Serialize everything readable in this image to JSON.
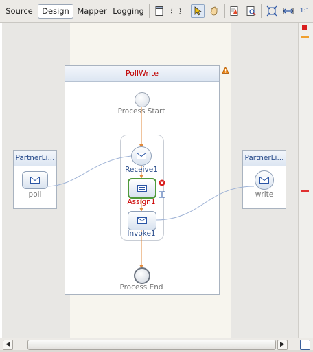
{
  "tabs": [
    {
      "label": "Source",
      "active": false
    },
    {
      "label": "Design",
      "active": true
    },
    {
      "label": "Mapper",
      "active": false
    },
    {
      "label": "Logging",
      "active": false
    }
  ],
  "toolbar_icons": [
    "palette-icon",
    "marquee-select-icon",
    "pointer-icon",
    "hand-icon",
    "validate-icon",
    "zoom-icon",
    "fit-diagram-icon",
    "fit-width-icon",
    "actual-size-icon"
  ],
  "toolbar_overflow_label": "1:1",
  "process": {
    "name": "PollWrite",
    "warning": true,
    "start_label": "Process Start",
    "end_label": "Process End",
    "activities": [
      {
        "label": "Receive1",
        "type": "receive",
        "error": false
      },
      {
        "label": "Assign1",
        "type": "assign",
        "error": true
      },
      {
        "label": "Invoke1",
        "type": "invoke",
        "error": false
      }
    ]
  },
  "partners": [
    {
      "header": "PartnerLi...",
      "port": "poll",
      "side": "left"
    },
    {
      "header": "PartnerLi...",
      "port": "write",
      "side": "right"
    }
  ],
  "colors": {
    "error_red": "#cc0000",
    "flow_orange": "#e28a3b",
    "link_blue": "#9fb3d6",
    "assign_green": "#4f9a3a"
  }
}
